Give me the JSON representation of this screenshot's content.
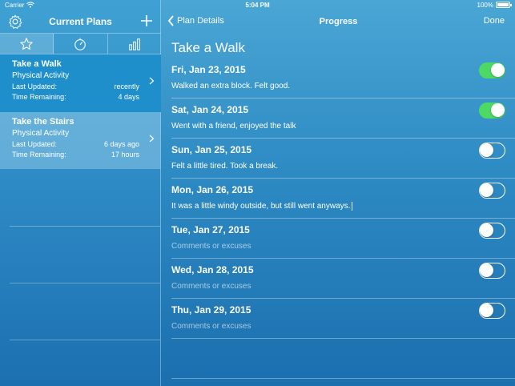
{
  "status_bar": {
    "carrier": "Carrier",
    "time": "5:04 PM",
    "battery": "100%"
  },
  "sidebar": {
    "title": "Current Plans",
    "plans": [
      {
        "title": "Take a Walk",
        "category": "Physical Activity",
        "last_updated_label": "Last Updated:",
        "last_updated": "recently",
        "remaining_label": "Time Remaining:",
        "remaining": "4 days"
      },
      {
        "title": "Take the Stairs",
        "category": "Physical Activity",
        "last_updated_label": "Last Updated:",
        "last_updated": "6 days ago",
        "remaining_label": "Time Remaining:",
        "remaining": "17 hours"
      }
    ]
  },
  "detail": {
    "back_label": "Plan Details",
    "title": "Progress",
    "done_label": "Done",
    "heading": "Take a Walk",
    "entries": [
      {
        "date": "Fri, Jan 23, 2015",
        "comment": "Walked an extra block. Felt good.",
        "checked": true
      },
      {
        "date": "Sat, Jan 24, 2015",
        "comment": "Went with a friend, enjoyed the talk",
        "checked": true
      },
      {
        "date": "Sun, Jan 25, 2015",
        "comment": "Felt a little tired. Took a break.",
        "checked": false
      },
      {
        "date": "Mon, Jan 26, 2015",
        "comment": "It was a little windy outside, but still went anyways.",
        "checked": false
      },
      {
        "date": "Tue, Jan 27, 2015",
        "comment": "Comments or excuses",
        "checked": false
      },
      {
        "date": "Wed, Jan 28, 2015",
        "comment": "Comments or excuses",
        "checked": false
      },
      {
        "date": "Thu, Jan 29, 2015",
        "comment": "Comments or excuses",
        "checked": false
      }
    ]
  }
}
